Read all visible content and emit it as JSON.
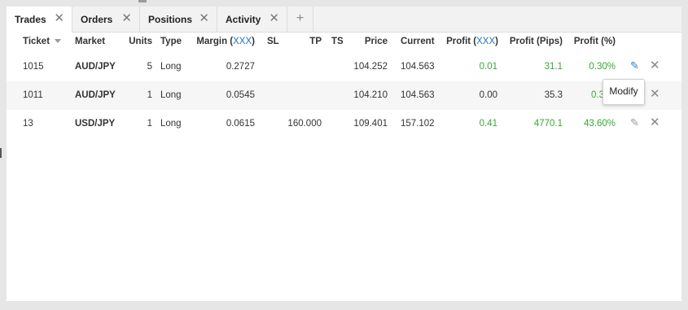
{
  "tabs": [
    {
      "label": "Trades"
    },
    {
      "label": "Orders"
    },
    {
      "label": "Positions"
    },
    {
      "label": "Activity"
    }
  ],
  "add_tab_label": "+",
  "close_glyph": "✕",
  "columns": {
    "ticket": "Ticket",
    "market": "Market",
    "units": "Units",
    "type": "Type",
    "margin": "Margin (",
    "margin_ccy": "XXX",
    "margin_end": ")",
    "sl": "SL",
    "tp": "TP",
    "ts": "TS",
    "price": "Price",
    "current": "Current",
    "profit": "Profit (",
    "profit_ccy": "XXX",
    "profit_end": ")",
    "profit_pips": "Profit (Pips)",
    "profit_pct": "Profit (%)"
  },
  "rows": [
    {
      "ticket": "1015",
      "market": "AUD/JPY",
      "units": "5",
      "type": "Long",
      "margin": "0.2727",
      "sl": "",
      "tp": "",
      "ts": "",
      "price": "104.252",
      "current": "104.563",
      "profit": "0.01",
      "pips": "31.1",
      "pct": "0.30%"
    },
    {
      "ticket": "1011",
      "market": "AUD/JPY",
      "units": "1",
      "type": "Long",
      "margin": "0.0545",
      "sl": "",
      "tp": "",
      "ts": "",
      "price": "104.210",
      "current": "104.563",
      "profit": "0.00",
      "pips": "35.3",
      "pct": "0.3"
    },
    {
      "ticket": "13",
      "market": "USD/JPY",
      "units": "1",
      "type": "Long",
      "margin": "0.0615",
      "sl": "",
      "tp": "160.000",
      "ts": "",
      "price": "109.401",
      "current": "157.102",
      "profit": "0.41",
      "pips": "4770.1",
      "pct": "43.60%"
    }
  ],
  "tooltip": "Modify",
  "colors": {
    "profit_positive": "#35a935",
    "edit_highlight": "#2a7ad6",
    "currency_link": "#1f6fbf"
  },
  "icons": {
    "edit": "pencil-icon",
    "close": "close-icon",
    "sort": "sort-down-icon"
  }
}
